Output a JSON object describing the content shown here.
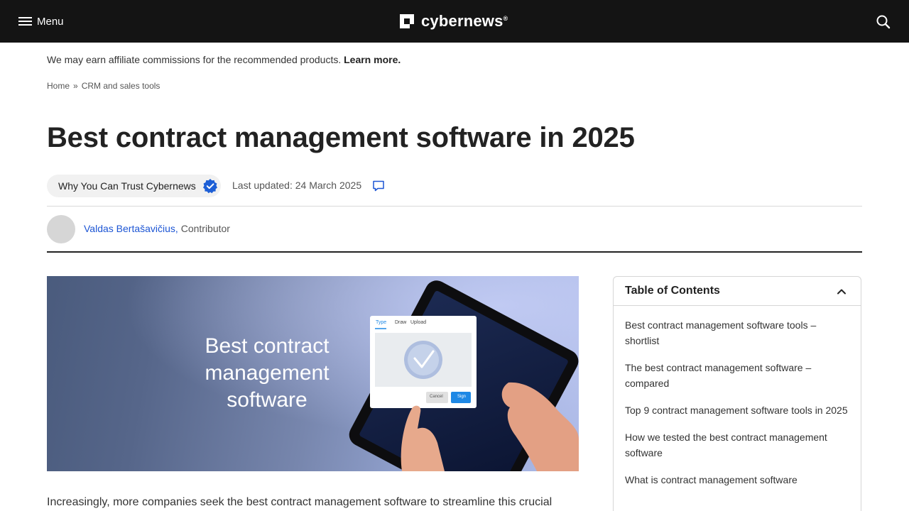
{
  "header": {
    "menu_label": "Menu",
    "logo_text": "cybernews",
    "logo_mark": "®",
    "background": "#141414"
  },
  "affiliate": {
    "text": "We may earn affiliate commissions for the recommended products.",
    "link": "Learn more."
  },
  "breadcrumb": {
    "items": [
      "Home",
      "CRM and sales tools"
    ],
    "separator": "»"
  },
  "article": {
    "title": "Best contract management software in 2025",
    "trust_label": "Why You Can Trust Cybernews",
    "last_updated": "Last updated: 24 March 2025",
    "author_name": "Valdas Bertašavičius,",
    "author_role": "Contributor",
    "author_color": "#1c55d4",
    "intro": "Increasingly, more companies seek the best contract management software to streamline this crucial"
  },
  "hero": {
    "text": "Best contract management software",
    "tablet_tabs": [
      "Type",
      "Draw",
      "Upload"
    ],
    "cancel_label": "Cancel",
    "sign_label": "Sign"
  },
  "toc": {
    "title": "Table of Contents",
    "items": [
      "Best contract management software tools – shortlist",
      "The best contract management software – compared",
      "Top 9 contract management software tools in 2025",
      "How we tested the best contract management software",
      "What is contract management software"
    ]
  },
  "icons": {
    "menu": "hamburger-icon",
    "search": "search-icon",
    "verified": "verified-badge-icon",
    "comment": "comment-icon",
    "toc_toggle": "chevron-up-icon"
  },
  "colors": {
    "accent_blue": "#1c55d4",
    "badge_blue": "#1d5fd6",
    "sign_button": "#1e88e5"
  }
}
